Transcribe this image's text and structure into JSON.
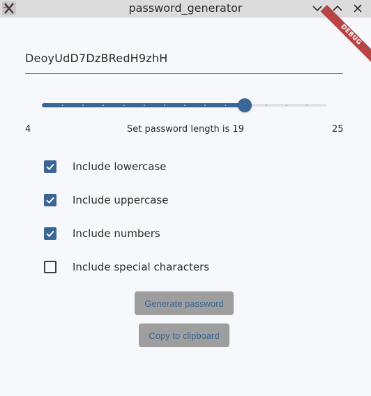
{
  "window": {
    "title": "password_generator"
  },
  "debug_banner": "DEBUG",
  "password": {
    "value": "DeoyUdD7DzBRedH9zhH"
  },
  "slider": {
    "min": 4,
    "max": 25,
    "value": 19,
    "min_label": "4",
    "max_label": "25",
    "caption": "Set password length is 19"
  },
  "options": [
    {
      "label": "Include lowercase",
      "checked": true
    },
    {
      "label": "Include uppercase",
      "checked": true
    },
    {
      "label": "Include numbers",
      "checked": true
    },
    {
      "label": "Include special characters",
      "checked": false
    }
  ],
  "buttons": {
    "generate_label": "Generate password",
    "copy_label": "Copy to clipboard"
  },
  "colors": {
    "accent": "#3a6594",
    "button_bg": "#9e9e9e",
    "debug_ribbon": "#b84545",
    "background": "#f7f8fc"
  }
}
